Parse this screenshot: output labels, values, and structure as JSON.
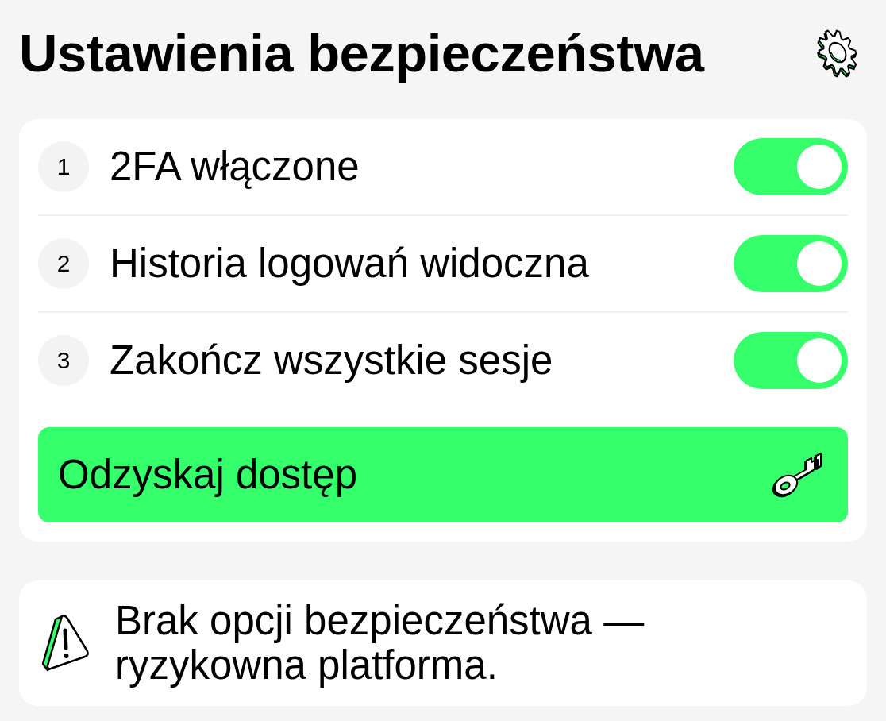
{
  "header": {
    "title": "Ustawienia bezpieczeństwa"
  },
  "settings": [
    {
      "number": "1",
      "label": "2FA włączone",
      "on": true
    },
    {
      "number": "2",
      "label": "Historia logowań widoczna",
      "on": true
    },
    {
      "number": "3",
      "label": "Zakończ wszystkie sesje",
      "on": true
    }
  ],
  "action_button": {
    "label": "Odzyskaj dostęp"
  },
  "warning": {
    "text": "Brak opcji bezpieczeństwa — ryzykowna platforma."
  }
}
